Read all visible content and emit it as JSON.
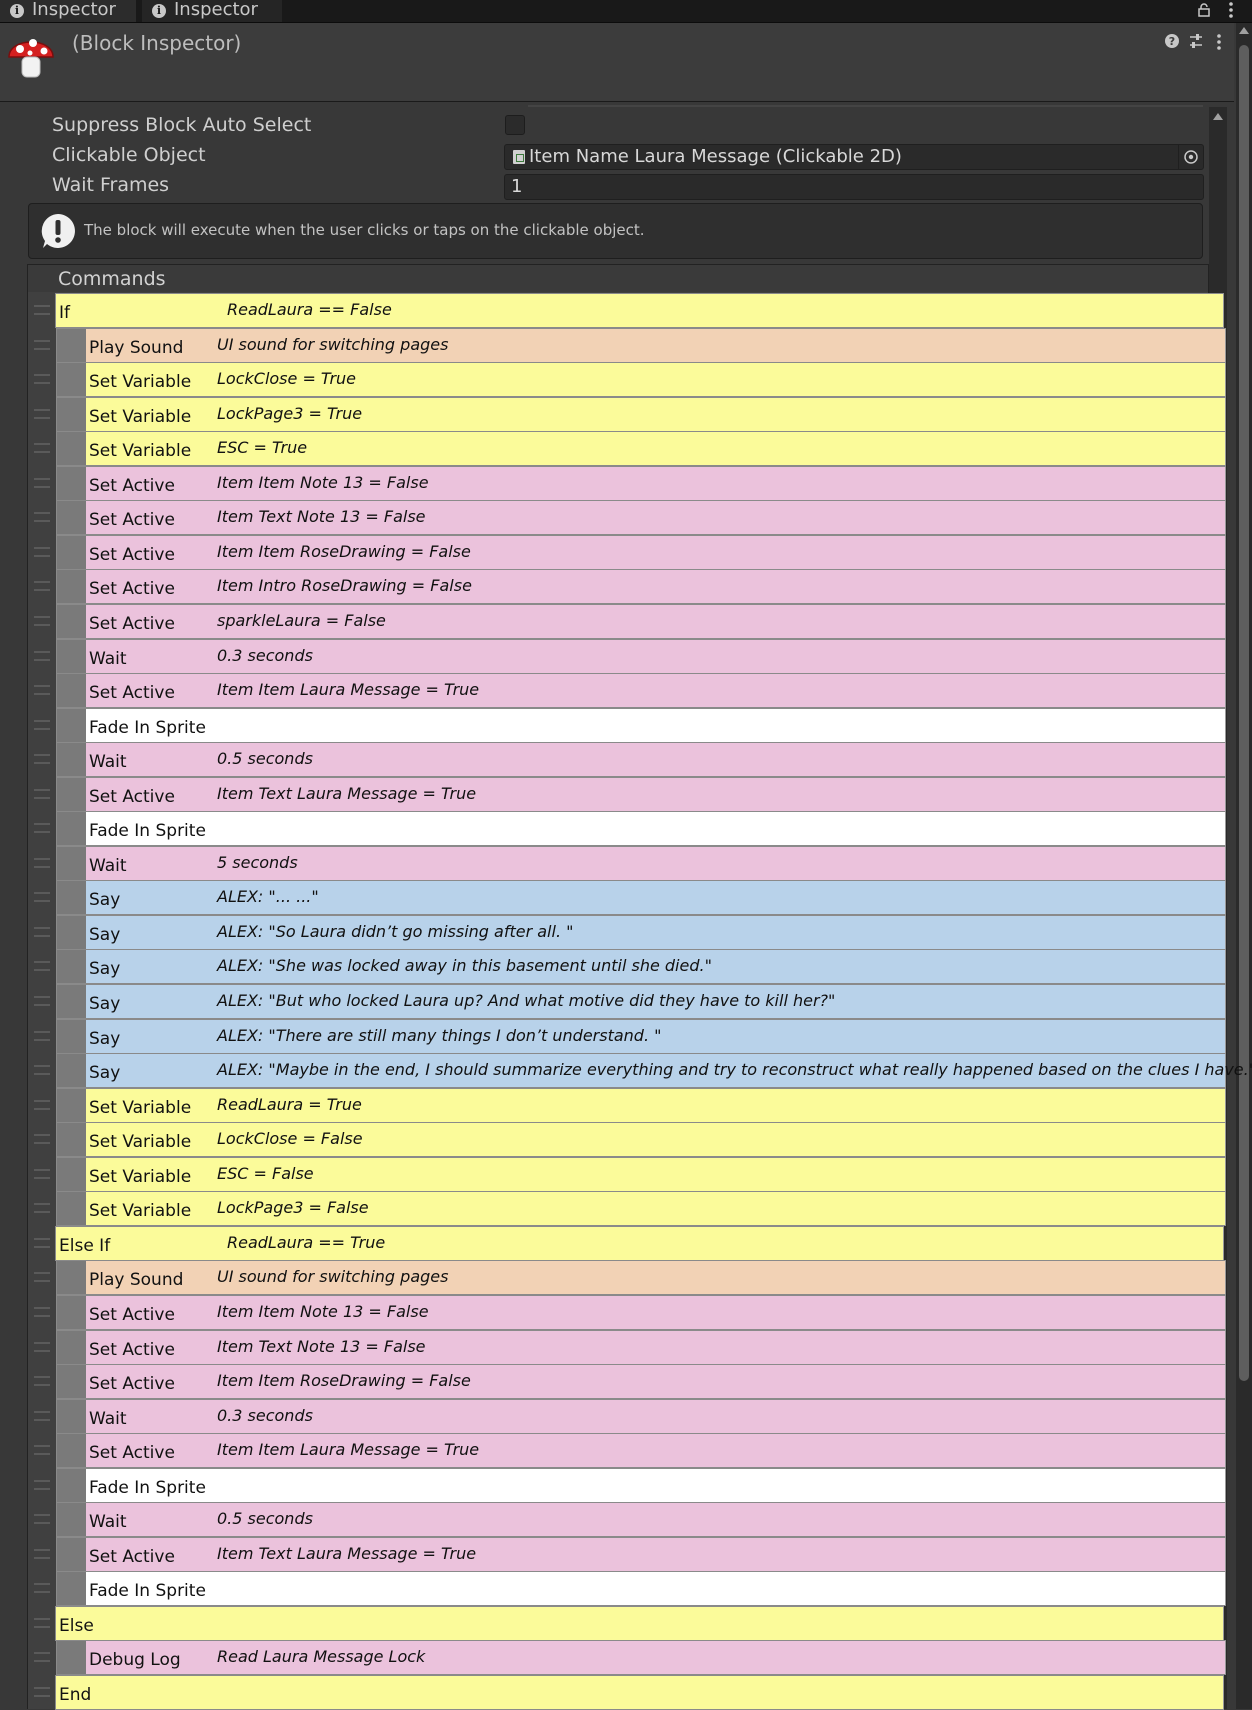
{
  "tabs": [
    {
      "label": "Inspector"
    },
    {
      "label": "Inspector"
    }
  ],
  "header": {
    "title": "(Block Inspector)"
  },
  "properties": {
    "suppress_label": "Suppress Block Auto Select",
    "suppress_checked": false,
    "clickable_label": "Clickable Object",
    "clickable_value": "Item Name Laura Message (Clickable 2D)",
    "wait_label": "Wait Frames",
    "wait_value": "1"
  },
  "help_text": "The block will execute when the user clicks or taps on the clickable object.",
  "commands_title": "Commands",
  "colors": {
    "variable": "#fbfb9a",
    "sound": "#f2d2b5",
    "active": "#ebc2dc",
    "say": "#b8d2ea",
    "fade": "#ffffff"
  },
  "commands": [
    {
      "name": "If",
      "summary": "ReadLaura == False",
      "type": "variable",
      "indent": 0
    },
    {
      "name": "Play Sound",
      "summary": "UI sound for switching pages",
      "type": "sound",
      "indent": 1
    },
    {
      "name": "Set Variable",
      "summary": "LockClose = True",
      "type": "variable",
      "indent": 1
    },
    {
      "name": "Set Variable",
      "summary": "LockPage3 = True",
      "type": "variable",
      "indent": 1
    },
    {
      "name": "Set Variable",
      "summary": "ESC = True",
      "type": "variable",
      "indent": 1
    },
    {
      "name": "Set Active",
      "summary": "Item Item Note 13 = False",
      "type": "active",
      "indent": 1
    },
    {
      "name": "Set Active",
      "summary": "Item Text Note 13 = False",
      "type": "active",
      "indent": 1
    },
    {
      "name": "Set Active",
      "summary": "Item Item RoseDrawing = False",
      "type": "active",
      "indent": 1
    },
    {
      "name": "Set Active",
      "summary": "Item Intro RoseDrawing = False",
      "type": "active",
      "indent": 1
    },
    {
      "name": "Set Active",
      "summary": "sparkleLaura = False",
      "type": "active",
      "indent": 1
    },
    {
      "name": "Wait",
      "summary": "0.3 seconds",
      "type": "active",
      "indent": 1
    },
    {
      "name": "Set Active",
      "summary": "Item Item Laura Message = True",
      "type": "active",
      "indent": 1
    },
    {
      "name": "Fade In Sprite",
      "summary": "",
      "type": "fade",
      "indent": 1
    },
    {
      "name": "Wait",
      "summary": "0.5 seconds",
      "type": "active",
      "indent": 1
    },
    {
      "name": "Set Active",
      "summary": "Item Text Laura Message = True",
      "type": "active",
      "indent": 1
    },
    {
      "name": "Fade In Sprite",
      "summary": "",
      "type": "fade",
      "indent": 1
    },
    {
      "name": "Wait",
      "summary": "5 seconds",
      "type": "active",
      "indent": 1
    },
    {
      "name": "Say",
      "summary": "ALEX: \"... ...\"",
      "type": "say",
      "indent": 1
    },
    {
      "name": "Say",
      "summary": "ALEX: \"So Laura didn’t go missing after all. \"",
      "type": "say",
      "indent": 1
    },
    {
      "name": "Say",
      "summary": "ALEX: \"She was locked away in this basement until she died.\"",
      "type": "say",
      "indent": 1
    },
    {
      "name": "Say",
      "summary": "ALEX: \"But who locked Laura up? And what motive did they have to kill her?\"",
      "type": "say",
      "indent": 1
    },
    {
      "name": "Say",
      "summary": "ALEX: \"There are still many things I don’t understand. \"",
      "type": "say",
      "indent": 1
    },
    {
      "name": "Say",
      "summary": "ALEX: \"Maybe in the end, I should summarize everything and try to reconstruct what really happened based on the clues I have.\"",
      "type": "say",
      "indent": 1
    },
    {
      "name": "Set Variable",
      "summary": "ReadLaura = True",
      "type": "variable",
      "indent": 1
    },
    {
      "name": "Set Variable",
      "summary": "LockClose = False",
      "type": "variable",
      "indent": 1
    },
    {
      "name": "Set Variable",
      "summary": "ESC = False",
      "type": "variable",
      "indent": 1
    },
    {
      "name": "Set Variable",
      "summary": "LockPage3 = False",
      "type": "variable",
      "indent": 1
    },
    {
      "name": "Else If",
      "summary": "ReadLaura == True",
      "type": "variable",
      "indent": 0
    },
    {
      "name": "Play Sound",
      "summary": "UI sound for switching pages",
      "type": "sound",
      "indent": 1
    },
    {
      "name": "Set Active",
      "summary": "Item Item Note 13 = False",
      "type": "active",
      "indent": 1
    },
    {
      "name": "Set Active",
      "summary": "Item Text Note 13 = False",
      "type": "active",
      "indent": 1
    },
    {
      "name": "Set Active",
      "summary": "Item Item RoseDrawing = False",
      "type": "active",
      "indent": 1
    },
    {
      "name": "Wait",
      "summary": "0.3 seconds",
      "type": "active",
      "indent": 1
    },
    {
      "name": "Set Active",
      "summary": "Item Item Laura Message = True",
      "type": "active",
      "indent": 1
    },
    {
      "name": "Fade In Sprite",
      "summary": "",
      "type": "fade",
      "indent": 1
    },
    {
      "name": "Wait",
      "summary": "0.5 seconds",
      "type": "active",
      "indent": 1
    },
    {
      "name": "Set Active",
      "summary": "Item Text Laura Message = True",
      "type": "active",
      "indent": 1
    },
    {
      "name": "Fade In Sprite",
      "summary": "",
      "type": "fade",
      "indent": 1
    },
    {
      "name": "Else",
      "summary": "",
      "type": "variable",
      "indent": 0
    },
    {
      "name": "Debug Log",
      "summary": "Read Laura Message Lock",
      "type": "active",
      "indent": 1
    },
    {
      "name": "End",
      "summary": "",
      "type": "variable",
      "indent": 0
    }
  ]
}
